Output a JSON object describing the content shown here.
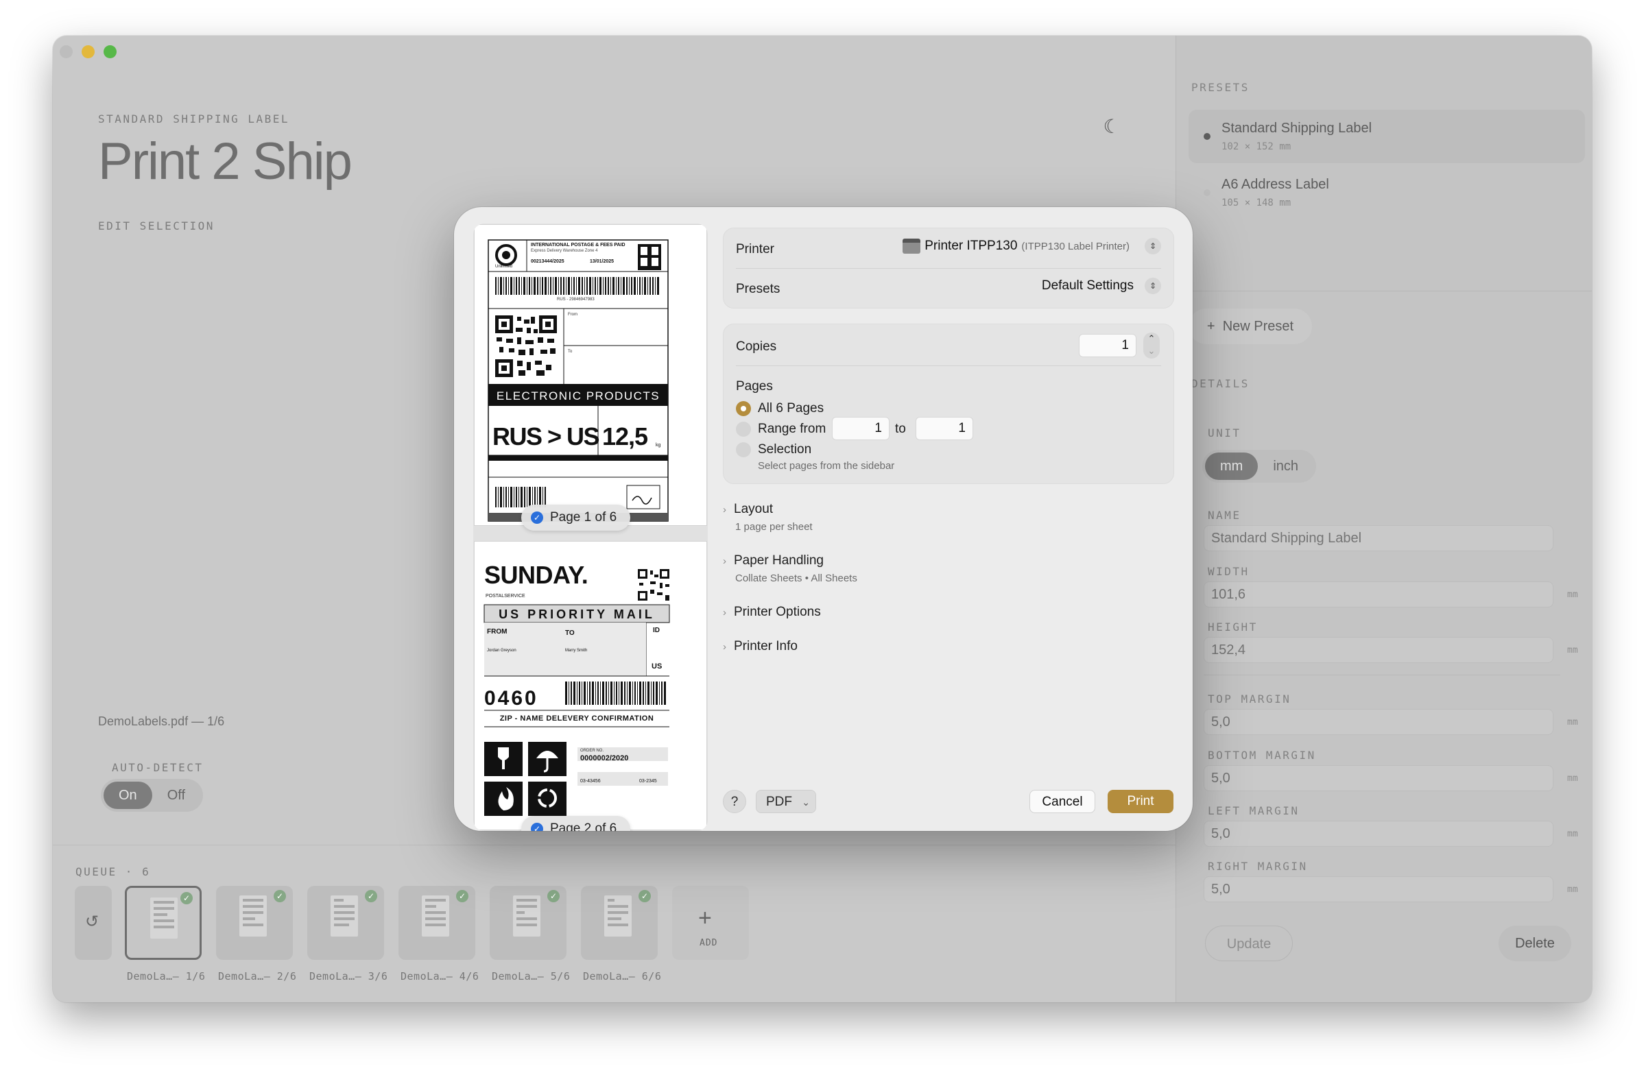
{
  "app": {
    "eyebrow": "STANDARD SHIPPING LABEL",
    "title": "Print 2 Ship",
    "edit_selection": "EDIT SELECTION",
    "file_label": "DemoLabels.pdf — 1/6",
    "auto_detect": {
      "label": "AUTO-DETECT",
      "on": "On",
      "off": "Off",
      "selected": "On"
    }
  },
  "queue": {
    "label": "QUEUE · 6",
    "add_label": "ADD",
    "items": [
      {
        "label": "DemoLa…— 1/6"
      },
      {
        "label": "DemoLa…— 2/6"
      },
      {
        "label": "DemoLa…— 3/6"
      },
      {
        "label": "DemoLa…— 4/6"
      },
      {
        "label": "DemoLa…— 5/6"
      },
      {
        "label": "DemoLa…— 6/6"
      }
    ]
  },
  "sidebar": {
    "presets_label": "PRESETS",
    "presets": [
      {
        "name": "Standard Shipping Label",
        "dims": "102 × 152 mm"
      },
      {
        "name": "A6 Address Label",
        "dims": "105 × 148 mm"
      }
    ],
    "new_preset": "New Preset",
    "details_label": "DETAILS",
    "unit_label": "UNIT",
    "unit_options": [
      "mm",
      "inch"
    ],
    "unit_selected": "mm",
    "name_label": "NAME",
    "name_value": "Standard Shipping Label",
    "width_label": "WIDTH",
    "width_value": "101,6",
    "height_label": "HEIGHT",
    "height_value": "152,4",
    "top_margin_label": "TOP MARGIN",
    "top_margin_value": "5,0",
    "bottom_margin_label": "BOTTOM MARGIN",
    "bottom_margin_value": "5,0",
    "left_margin_label": "LEFT MARGIN",
    "left_margin_value": "5,0",
    "right_margin_label": "RIGHT MARGIN",
    "right_margin_value": "5,0",
    "unit_suffix": "mm",
    "update": "Update",
    "delete": "Delete"
  },
  "print_dialog": {
    "printer_label": "Printer",
    "printer_name": "Printer ITPP130",
    "printer_model": "(ITPP130 Label Printer)",
    "presets_label": "Presets",
    "presets_value": "Default Settings",
    "copies_label": "Copies",
    "copies_value": "1",
    "pages_label": "Pages",
    "all_pages": "All 6 Pages",
    "range_from": "Range from",
    "range_start": "1",
    "range_to": "to",
    "range_end": "1",
    "selection": "Selection",
    "selection_hint": "Select pages from the sidebar",
    "layout": "Layout",
    "layout_sub": "1 page per sheet",
    "paper_handling": "Paper Handling",
    "paper_handling_sub": "Collate Sheets • All Sheets",
    "printer_options": "Printer Options",
    "printer_info": "Printer Info",
    "help": "?",
    "pdf": "PDF",
    "cancel": "Cancel",
    "print": "Print",
    "accent": "#b48d3d"
  },
  "preview": {
    "page1_badge": "Page 1 of 6",
    "page2_badge": "Page 2 of 6",
    "label1": {
      "header": "INTERNATIONAL POSTAGE & FEES PAID",
      "subheader": "Express Delivery Warehouse Zone 4",
      "order": "00213444/2025",
      "date": "13/01/2025",
      "brand": "Unlimited",
      "tracking": "RUS - 29846947983",
      "from": "From",
      "to": "To",
      "category": "ELECTRONIC PRODUCTS",
      "route": "RUS > US",
      "weight": "12,5",
      "weight_unit": "kg"
    },
    "label2": {
      "brand": "SUNDAY.",
      "brand_sub": "POSTALSERVICE",
      "service": "US PRIORITY MAIL",
      "from": "FROM",
      "to": "TO",
      "id": "ID",
      "country": "US",
      "sender": "Jordan Greyson",
      "recipient": "Marry Smith",
      "code": "0460",
      "confirmation": "ZIP - NAME DELEVERY CONFIRMATION",
      "order_no_label": "ORDER NO.",
      "order_no": "0000002/2020",
      "ref_number": "03-43456",
      "lot_number": "03-2345"
    }
  },
  "colors": {
    "window_bg": "#c9c9c9",
    "modal_bg": "#ececec",
    "check": "#2a6fdb"
  }
}
